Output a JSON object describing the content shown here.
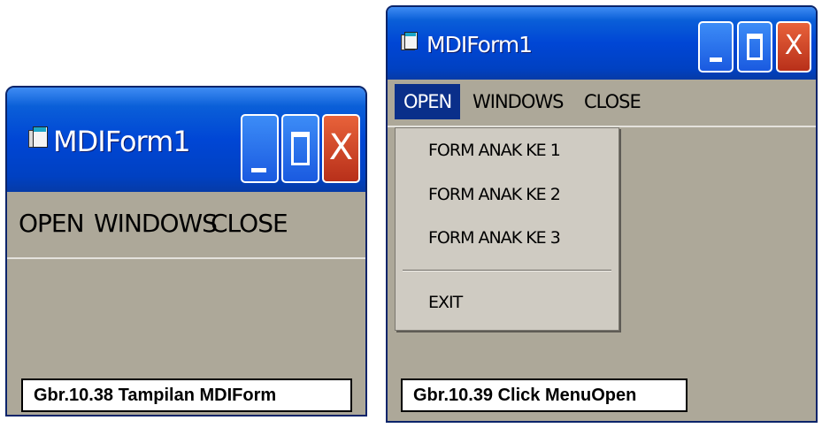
{
  "figure1": {
    "window_title": "MDIForm1",
    "title_icon": "form-window-icon",
    "controls": {
      "minimize": "minimize-icon",
      "maximize": "maximize-icon",
      "close": "X"
    },
    "menu": [
      "OPEN",
      "WINDOWS",
      "CLOSE"
    ],
    "caption": "Gbr.10.38 Tampilan MDIForm"
  },
  "figure2": {
    "window_title": "MDIForm1",
    "title_icon": "form-window-icon",
    "controls": {
      "minimize": "minimize-icon",
      "maximize": "maximize-icon",
      "close": "X"
    },
    "menu": [
      "OPEN",
      "WINDOWS",
      "CLOSE"
    ],
    "active_menu": "OPEN",
    "dropdown": [
      "FORM ANAK KE 1",
      "FORM ANAK KE 2",
      "FORM ANAK KE 3",
      "EXIT"
    ],
    "caption": "Gbr.10.39 Click MenuOpen"
  },
  "colors": {
    "titlebar": "#0046d5",
    "window_body": "#ada899",
    "menu_highlight": "#0a2f8a",
    "close_button": "#c8401f"
  }
}
